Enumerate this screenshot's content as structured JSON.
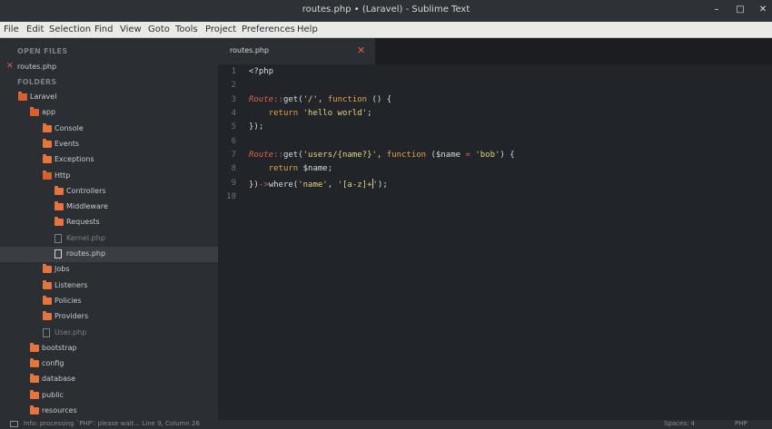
{
  "window": {
    "title": "routes.php • (Laravel) - Sublime Text",
    "min_glyph": "–",
    "max_glyph": "□",
    "close_glyph": "✕"
  },
  "menu": [
    "File",
    "Edit",
    "Selection",
    "Find",
    "View",
    "Goto",
    "Tools",
    "Project",
    "Preferences",
    "Help"
  ],
  "sidebar": {
    "open_files_header": "OPEN FILES",
    "open_file": "routes.php",
    "folders_header": "FOLDERS",
    "tree": [
      {
        "label": "Laravel",
        "type": "folder-open",
        "depth": 0
      },
      {
        "label": "app",
        "type": "folder-open",
        "depth": 1
      },
      {
        "label": "Console",
        "type": "folder",
        "depth": 2
      },
      {
        "label": "Events",
        "type": "folder",
        "depth": 2
      },
      {
        "label": "Exceptions",
        "type": "folder",
        "depth": 2
      },
      {
        "label": "Http",
        "type": "folder-open",
        "depth": 2
      },
      {
        "label": "Controllers",
        "type": "folder",
        "depth": 3
      },
      {
        "label": "Middleware",
        "type": "folder",
        "depth": 3
      },
      {
        "label": "Requests",
        "type": "folder",
        "depth": 3
      },
      {
        "label": "Kernel.php",
        "type": "file",
        "depth": 3
      },
      {
        "label": "routes.php",
        "type": "file-active",
        "depth": 3
      },
      {
        "label": "Jobs",
        "type": "folder",
        "depth": 2
      },
      {
        "label": "Listeners",
        "type": "folder",
        "depth": 2
      },
      {
        "label": "Policies",
        "type": "folder",
        "depth": 2
      },
      {
        "label": "Providers",
        "type": "folder",
        "depth": 2
      },
      {
        "label": "User.php",
        "type": "file",
        "depth": 2
      },
      {
        "label": "bootstrap",
        "type": "folder",
        "depth": 1
      },
      {
        "label": "config",
        "type": "folder",
        "depth": 1
      },
      {
        "label": "database",
        "type": "folder",
        "depth": 1
      },
      {
        "label": "public",
        "type": "folder",
        "depth": 1
      },
      {
        "label": "resources",
        "type": "folder",
        "depth": 1
      }
    ]
  },
  "tab": {
    "name": "routes.php",
    "close_glyph": "✕"
  },
  "editor": {
    "lines": [
      {
        "n": "1",
        "tokens": [
          {
            "t": "<?php",
            "c": ""
          }
        ]
      },
      {
        "n": "2",
        "tokens": []
      },
      {
        "n": "3",
        "tokens": [
          {
            "t": "Route",
            "c": "cls"
          },
          {
            "t": "::",
            "c": "op"
          },
          {
            "t": "get(",
            "c": ""
          },
          {
            "t": "'/'",
            "c": "str"
          },
          {
            "t": ", ",
            "c": ""
          },
          {
            "t": "function",
            "c": "kw"
          },
          {
            "t": " () {",
            "c": ""
          }
        ]
      },
      {
        "n": "4",
        "tokens": [
          {
            "t": "    ",
            "c": ""
          },
          {
            "t": "return",
            "c": "kw"
          },
          {
            "t": " ",
            "c": ""
          },
          {
            "t": "'hello world'",
            "c": "str"
          },
          {
            "t": ";",
            "c": ""
          }
        ]
      },
      {
        "n": "5",
        "tokens": [
          {
            "t": "});",
            "c": ""
          }
        ]
      },
      {
        "n": "6",
        "tokens": []
      },
      {
        "n": "7",
        "tokens": [
          {
            "t": "Route",
            "c": "cls"
          },
          {
            "t": "::",
            "c": "op"
          },
          {
            "t": "get(",
            "c": ""
          },
          {
            "t": "'users/{name?}'",
            "c": "str"
          },
          {
            "t": ", ",
            "c": ""
          },
          {
            "t": "function",
            "c": "kw"
          },
          {
            "t": " (",
            "c": ""
          },
          {
            "t": "$name",
            "c": "var"
          },
          {
            "t": " = ",
            "c": "op"
          },
          {
            "t": "'bob'",
            "c": "str"
          },
          {
            "t": ") {",
            "c": ""
          }
        ]
      },
      {
        "n": "8",
        "tokens": [
          {
            "t": "    ",
            "c": ""
          },
          {
            "t": "return",
            "c": "kw"
          },
          {
            "t": " ",
            "c": ""
          },
          {
            "t": "$name",
            "c": "var"
          },
          {
            "t": ";",
            "c": ""
          }
        ]
      },
      {
        "n": "9",
        "tokens": [
          {
            "t": "})",
            "c": ""
          },
          {
            "t": "->",
            "c": "op"
          },
          {
            "t": "where(",
            "c": ""
          },
          {
            "t": "'name'",
            "c": "str"
          },
          {
            "t": ", ",
            "c": ""
          },
          {
            "t": "'[a-z]+",
            "c": "str"
          },
          {
            "t": "|",
            "c": "cursor"
          },
          {
            "t": "'",
            "c": "str"
          },
          {
            "t": ");",
            "c": ""
          }
        ]
      },
      {
        "n": "10",
        "tokens": []
      }
    ]
  },
  "status": {
    "message": "Info: processing `PHP': please wait... Line 9, Column 26",
    "spaces": "Spaces: 4",
    "syntax": "PHP"
  },
  "colors": {
    "accent": "#e0624a",
    "folder": "#e7733d",
    "string": "#e6d37a",
    "keyword": "#e8a14c"
  }
}
